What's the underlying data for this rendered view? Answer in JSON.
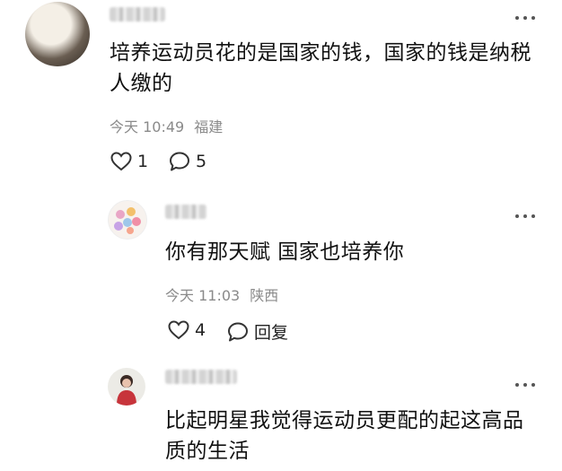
{
  "comments": [
    {
      "username": "",
      "text": "培养运动员花的是国家的钱，国家的钱是纳税人缴的",
      "time": "今天 10:49",
      "location": "福建",
      "likes": "1",
      "replies": "5"
    },
    {
      "username": "",
      "text": "你有那天赋 国家也培养你",
      "time": "今天 11:03",
      "location": "陕西",
      "likes": "4",
      "reply_label": "回复"
    },
    {
      "username": "",
      "text": "比起明星我觉得运动员更配的起这高品质的生活"
    }
  ],
  "icons": {
    "more": "more-dots-icon",
    "like": "heart-icon",
    "comment": "comment-bubble-icon"
  }
}
